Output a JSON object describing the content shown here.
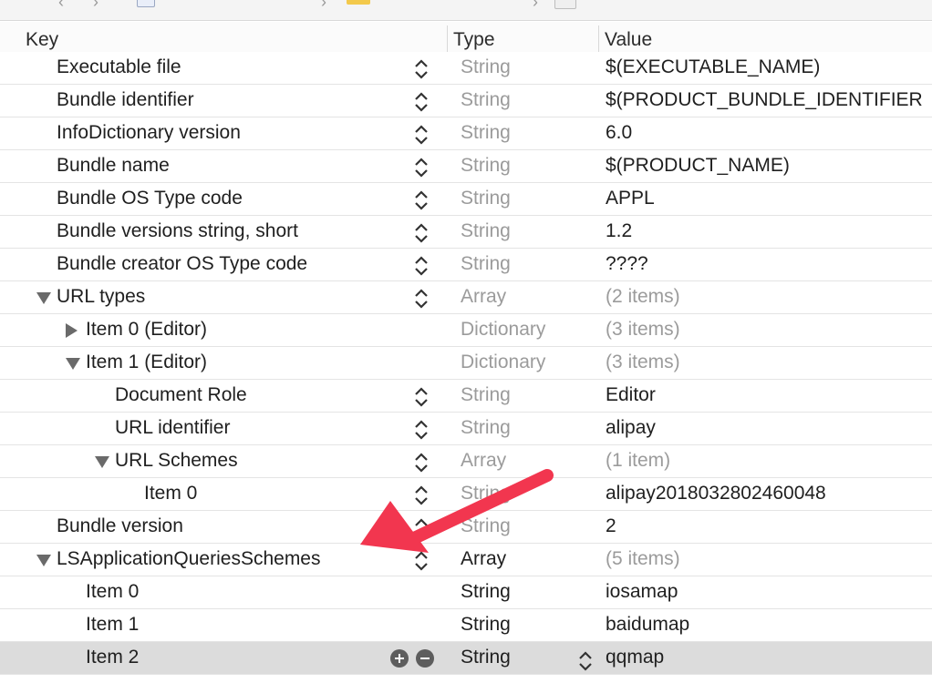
{
  "header": {
    "key_label": "Key",
    "type_label": "Type",
    "value_label": "Value"
  },
  "rows": [
    {
      "key": "Executable file",
      "type": "String",
      "value": "$(EXECUTABLE_NAME)",
      "indent": 0
    },
    {
      "key": "Bundle identifier",
      "type": "String",
      "value": "$(PRODUCT_BUNDLE_IDENTIFIER",
      "indent": 0
    },
    {
      "key": "InfoDictionary version",
      "type": "String",
      "value": "6.0",
      "indent": 0
    },
    {
      "key": "Bundle name",
      "type": "String",
      "value": "$(PRODUCT_NAME)",
      "indent": 0
    },
    {
      "key": "Bundle OS Type code",
      "type": "String",
      "value": "APPL",
      "indent": 0
    },
    {
      "key": "Bundle versions string, short",
      "type": "String",
      "value": "1.2",
      "indent": 0
    },
    {
      "key": "Bundle creator OS Type code",
      "type": "String",
      "value": "????",
      "indent": 0
    },
    {
      "key": "URL types",
      "type": "Array",
      "value": "(2 items)",
      "indent": 0,
      "disclosure": "expanded"
    },
    {
      "key": "Item 0 (Editor)",
      "type": "Dictionary",
      "value": "(3 items)",
      "indent": 1,
      "disclosure": "collapsed"
    },
    {
      "key": "Item 1 (Editor)",
      "type": "Dictionary",
      "value": "(3 items)",
      "indent": 1,
      "disclosure": "expanded"
    },
    {
      "key": "Document Role",
      "type": "String",
      "value": "Editor",
      "indent": 2
    },
    {
      "key": "URL identifier",
      "type": "String",
      "value": "alipay",
      "indent": 2
    },
    {
      "key": "URL Schemes",
      "type": "Array",
      "value": "(1 item)",
      "indent": 2,
      "disclosure": "expanded"
    },
    {
      "key": "Item 0",
      "type": "String",
      "value": "alipay2018032802460048",
      "indent": 3
    },
    {
      "key": "Bundle version",
      "type": "String",
      "value": "2",
      "indent": 0
    },
    {
      "key": "LSApplicationQueriesSchemes",
      "type": "Array",
      "value": "(5 items)",
      "indent": 0,
      "disclosure": "expanded"
    },
    {
      "key": "Item 0",
      "type": "String",
      "value": "iosamap",
      "indent": 1
    },
    {
      "key": "Item 1",
      "type": "String",
      "value": "baidumap",
      "indent": 1
    },
    {
      "key": "Item 2",
      "type": "String",
      "value": "qqmap",
      "indent": 1,
      "selected": true
    }
  ],
  "icons": {
    "stepper": "up-down-chevron-icon",
    "add": "plus-circle-icon",
    "remove": "minus-circle-icon",
    "annotation": "red-arrow-icon"
  },
  "colors": {
    "selected_row": "#dcdcdc",
    "muted_text": "#9b9b9b",
    "annotation_arrow": "#f2364f"
  }
}
